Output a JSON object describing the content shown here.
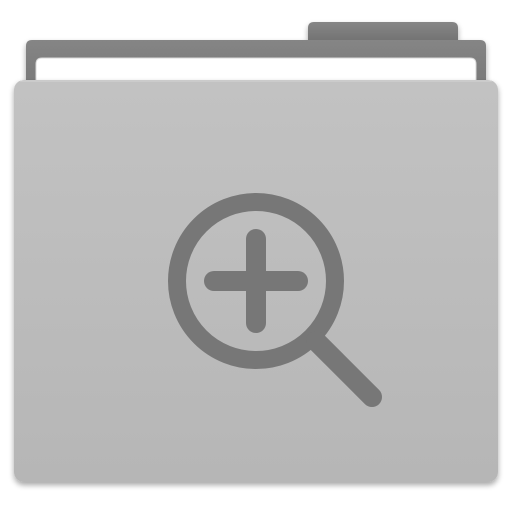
{
  "icon": {
    "kind": "folder-zoom-in-icon",
    "colors": {
      "folder_front": "#bababa",
      "folder_back": "#7d7d7d",
      "paper": "#ffffff",
      "glyph": "#777777",
      "shadow": "#000000"
    }
  }
}
